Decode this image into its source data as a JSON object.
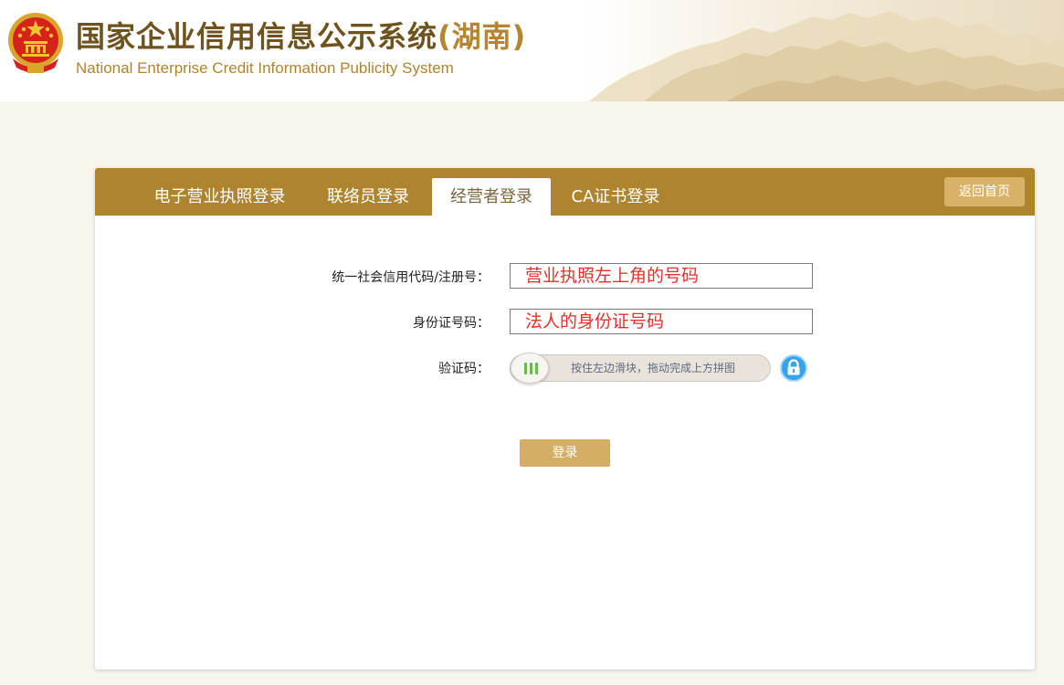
{
  "header": {
    "title": "国家企业信用信息公示系统",
    "province": "(湖南)",
    "subtitle": "National Enterprise Credit Information Publicity System",
    "emblem_icon": "national-emblem-icon"
  },
  "tabs": [
    {
      "label": "电子营业执照登录",
      "active": false
    },
    {
      "label": "联络员登录",
      "active": false
    },
    {
      "label": "经营者登录",
      "active": true
    },
    {
      "label": "CA证书登录",
      "active": false
    }
  ],
  "back_home_label": "返回首页",
  "form": {
    "credit_code": {
      "label": "统一社会信用代码/注册号：",
      "value": "营业执照左上角的号码"
    },
    "id_number": {
      "label": "身份证号码：",
      "value": "法人的身份证号码"
    },
    "captcha": {
      "label": "验证码：",
      "slider_hint": "按住左边滑块，拖动完成上方拼图",
      "lock_icon": "lock-icon",
      "handle_icon": "grip-icon"
    }
  },
  "login_label": "登录",
  "colors": {
    "brand_gold": "#ae842f",
    "button_gold": "#d4ad66",
    "input_text_red": "#e0332e",
    "lock_blue": "#35a4e8",
    "grip_green": "#66b94a"
  }
}
